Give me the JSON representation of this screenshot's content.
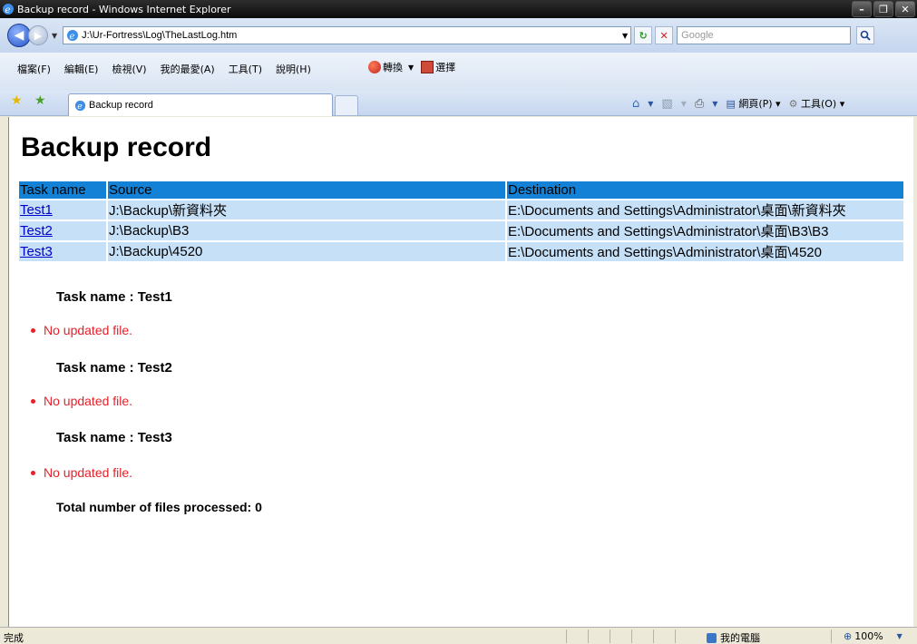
{
  "window": {
    "title": "Backup record - Windows Internet Explorer",
    "buttons": [
      "–",
      "❐",
      "✕"
    ]
  },
  "address_bar": {
    "url": "J:\\Ur-Fortress\\Log\\TheLastLog.htm",
    "search_placeholder": "Google"
  },
  "menu": {
    "items": [
      "檔案(F)",
      "編輯(E)",
      "檢視(V)",
      "我的最愛(A)",
      "工具(T)",
      "說明(H)"
    ],
    "convert": "轉換",
    "select": "選擇"
  },
  "tab": {
    "label": "Backup record"
  },
  "command_bar": {
    "page": "網頁(P)",
    "tools": "工具(O)"
  },
  "page": {
    "title": "Backup record",
    "table": {
      "headers": [
        "Task name",
        "Source",
        "Destination"
      ],
      "rows": [
        [
          "Test1",
          "J:\\Backup\\新資料夾",
          "E:\\Documents and Settings\\Administrator\\桌面\\新資料夾"
        ],
        [
          "Test2",
          "J:\\Backup\\B3",
          "E:\\Documents and Settings\\Administrator\\桌面\\B3\\B3"
        ],
        [
          "Test3",
          "J:\\Backup\\4520",
          "E:\\Documents and Settings\\Administrator\\桌面\\4520"
        ]
      ]
    },
    "tasks": [
      {
        "heading": "Task name : Test1",
        "message": "No updated file."
      },
      {
        "heading": "Task name : Test2",
        "message": "No updated file."
      },
      {
        "heading": "Task name : Test3",
        "message": "No updated file."
      }
    ],
    "total": "Total number of files processed: 0"
  },
  "status_bar": {
    "status": "完成",
    "zone": "我的電腦",
    "zoom": "100%"
  },
  "colors": {
    "header_bg": "#1382d6",
    "row_bg": "#c6e0f7",
    "message_red": "#e8202a",
    "link_blue": "#0000cc"
  }
}
